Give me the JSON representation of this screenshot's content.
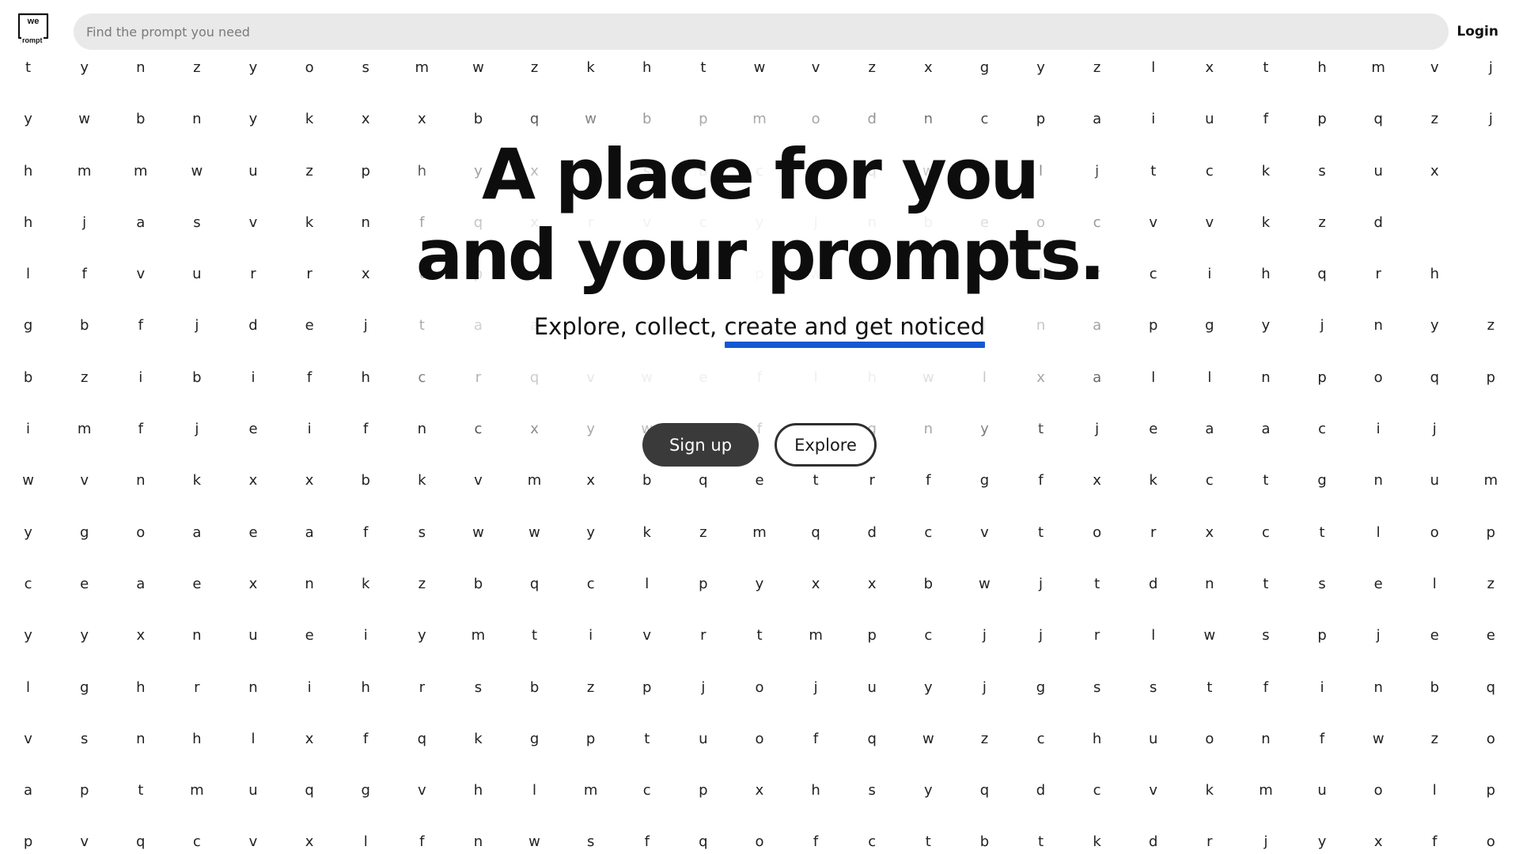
{
  "header": {
    "logo_top": "we",
    "logo_bottom": "rompt",
    "search_placeholder": "Find the prompt you need",
    "login_label": "Login"
  },
  "hero": {
    "title_line1": "A place for you",
    "title_line2": "and your prompts.",
    "subtitle_plain": "Explore, collect, ",
    "subtitle_highlight": "create and get noticed",
    "signup_label": "Sign up",
    "explore_label": "Explore"
  },
  "colors": {
    "accent_underline": "#1358d4",
    "primary_button": "#3a3a3a",
    "search_background": "#e9e9e9"
  },
  "letter_grid": [
    "tynzyosmwzkhtwvzxgyzlxthmvj",
    "ywbnykxxbqwbpmodncpaiufpqzj",
    "hmmwuzphyxtsbcfqwrljtcksux",
    "hjasvknfqxrvcyjnbeocvvkzd",
    "lfvurrxtpylgnpwykqlrcihqrh",
    "gbfjdejtaaepkyxqnlnapgyjnyz",
    "bzibifhcrqvweflhwlxallnpoqp",
    "imfjeifncxywefwgnytjeaacij",
    "wvnkxxbkvmxbqetrfgfxkctgnum",
    "ygoaeafswwykzmqdcvtorxctlop",
    "ceaexnkzbqclpyxxbwjtdntselz",
    "yyxnueiymtivrtmpcjjrlwspjee",
    "lghrnihrsbzpjojuyjgsstfinbq",
    "vsnhlxfqkgptuofqwzchuonfwzo",
    "aptmuqgvhlmcpxhsyqdcvkmuolp",
    "pvqcvxlfnwsfqofctbtkdrjyxfo"
  ]
}
